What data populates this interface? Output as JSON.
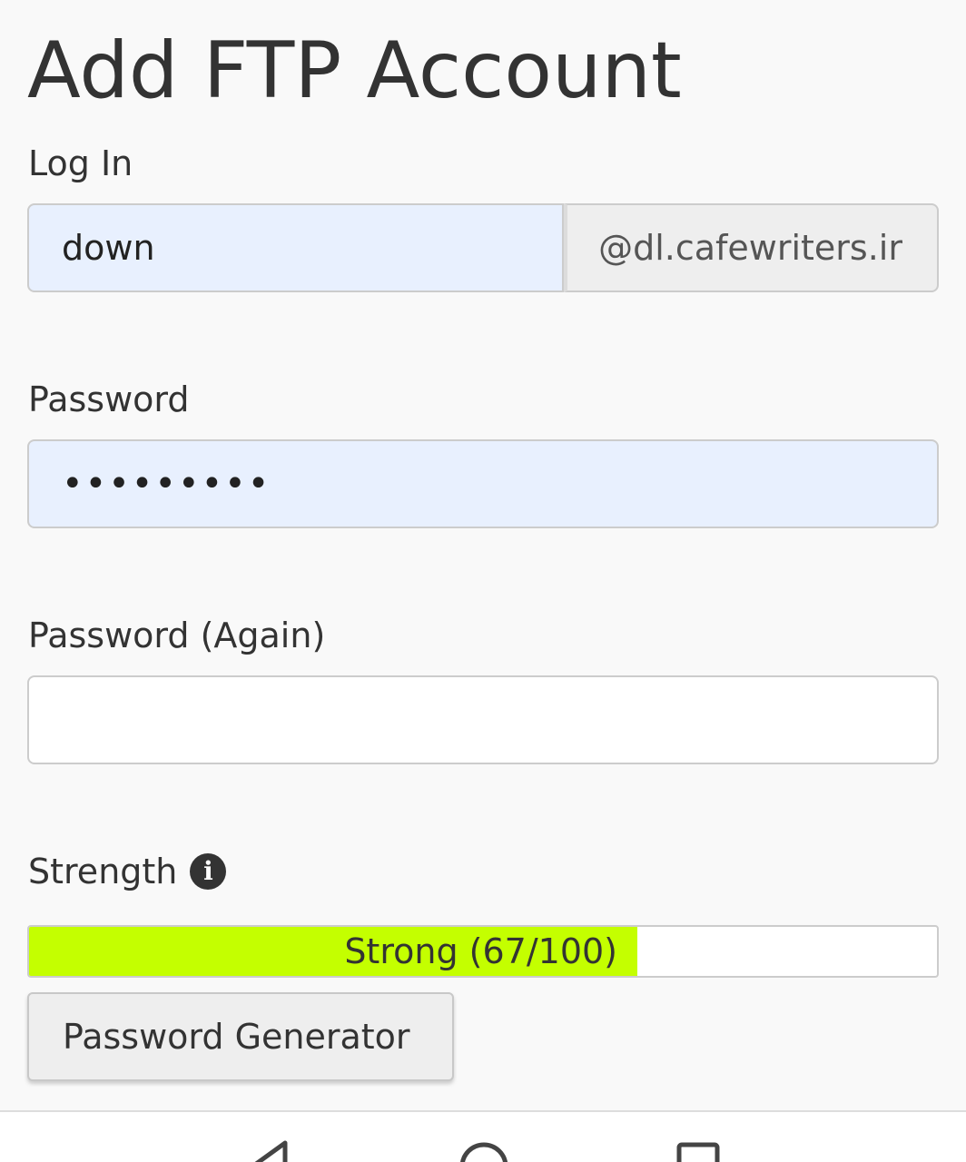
{
  "page": {
    "title": "Add FTP Account"
  },
  "form": {
    "login": {
      "label": "Log In",
      "value": "down",
      "domain_suffix": "@dl.cafewriters.ir"
    },
    "password": {
      "label": "Password",
      "value": "•••••••••"
    },
    "password_again": {
      "label": "Password (Again)",
      "value": ""
    },
    "strength": {
      "label": "Strength",
      "info_icon": "info-circle-icon",
      "meter_text": "Strong (67/100)",
      "score": 67,
      "max": 100,
      "fill_color": "#c4ff00"
    },
    "generator_button_label": "Password Generator"
  },
  "navbar": {
    "icons": [
      "back-triangle-icon",
      "home-circle-icon",
      "recent-apps-square-icon"
    ]
  },
  "colors": {
    "autofill_background": "#e8f0fe",
    "addon_background": "#eeeeee",
    "text": "#333333"
  }
}
